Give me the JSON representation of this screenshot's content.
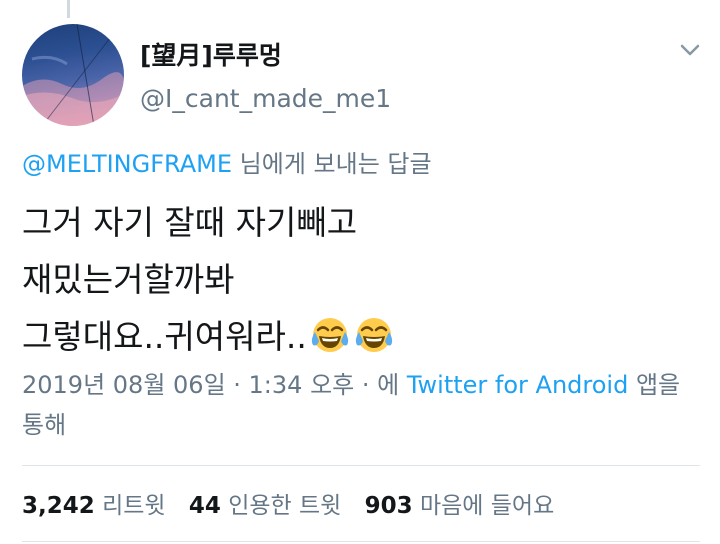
{
  "profile": {
    "display_name": "[望月]루루멍",
    "handle": "@I_cant_made_me1"
  },
  "reply": {
    "mention": "@MELTINGFRAME",
    "suffix": " 님에게 보내는 답글"
  },
  "tweet": {
    "lines": [
      "그거 자기 잘때 자기빼고",
      "재밌는거할까봐",
      "그렇대요..귀여워라.."
    ],
    "emoji": [
      "face-with-tears-of-joy-icon",
      "face-with-tears-of-joy-icon"
    ]
  },
  "meta": {
    "timestamp": "2019년 08월 06일 · 1:34 오후 · 에 ",
    "source": "Twitter for Android",
    "suffix": " 앱을 통해"
  },
  "stats": {
    "retweets_count": "3,242",
    "retweets_label": "리트윗",
    "quotes_count": "44",
    "quotes_label": "인용한 트윗",
    "likes_count": "903",
    "likes_label": "마음에 들어요"
  },
  "colors": {
    "link": "#1da1f2",
    "secondary_text": "#657786",
    "primary_text": "#14171a"
  }
}
